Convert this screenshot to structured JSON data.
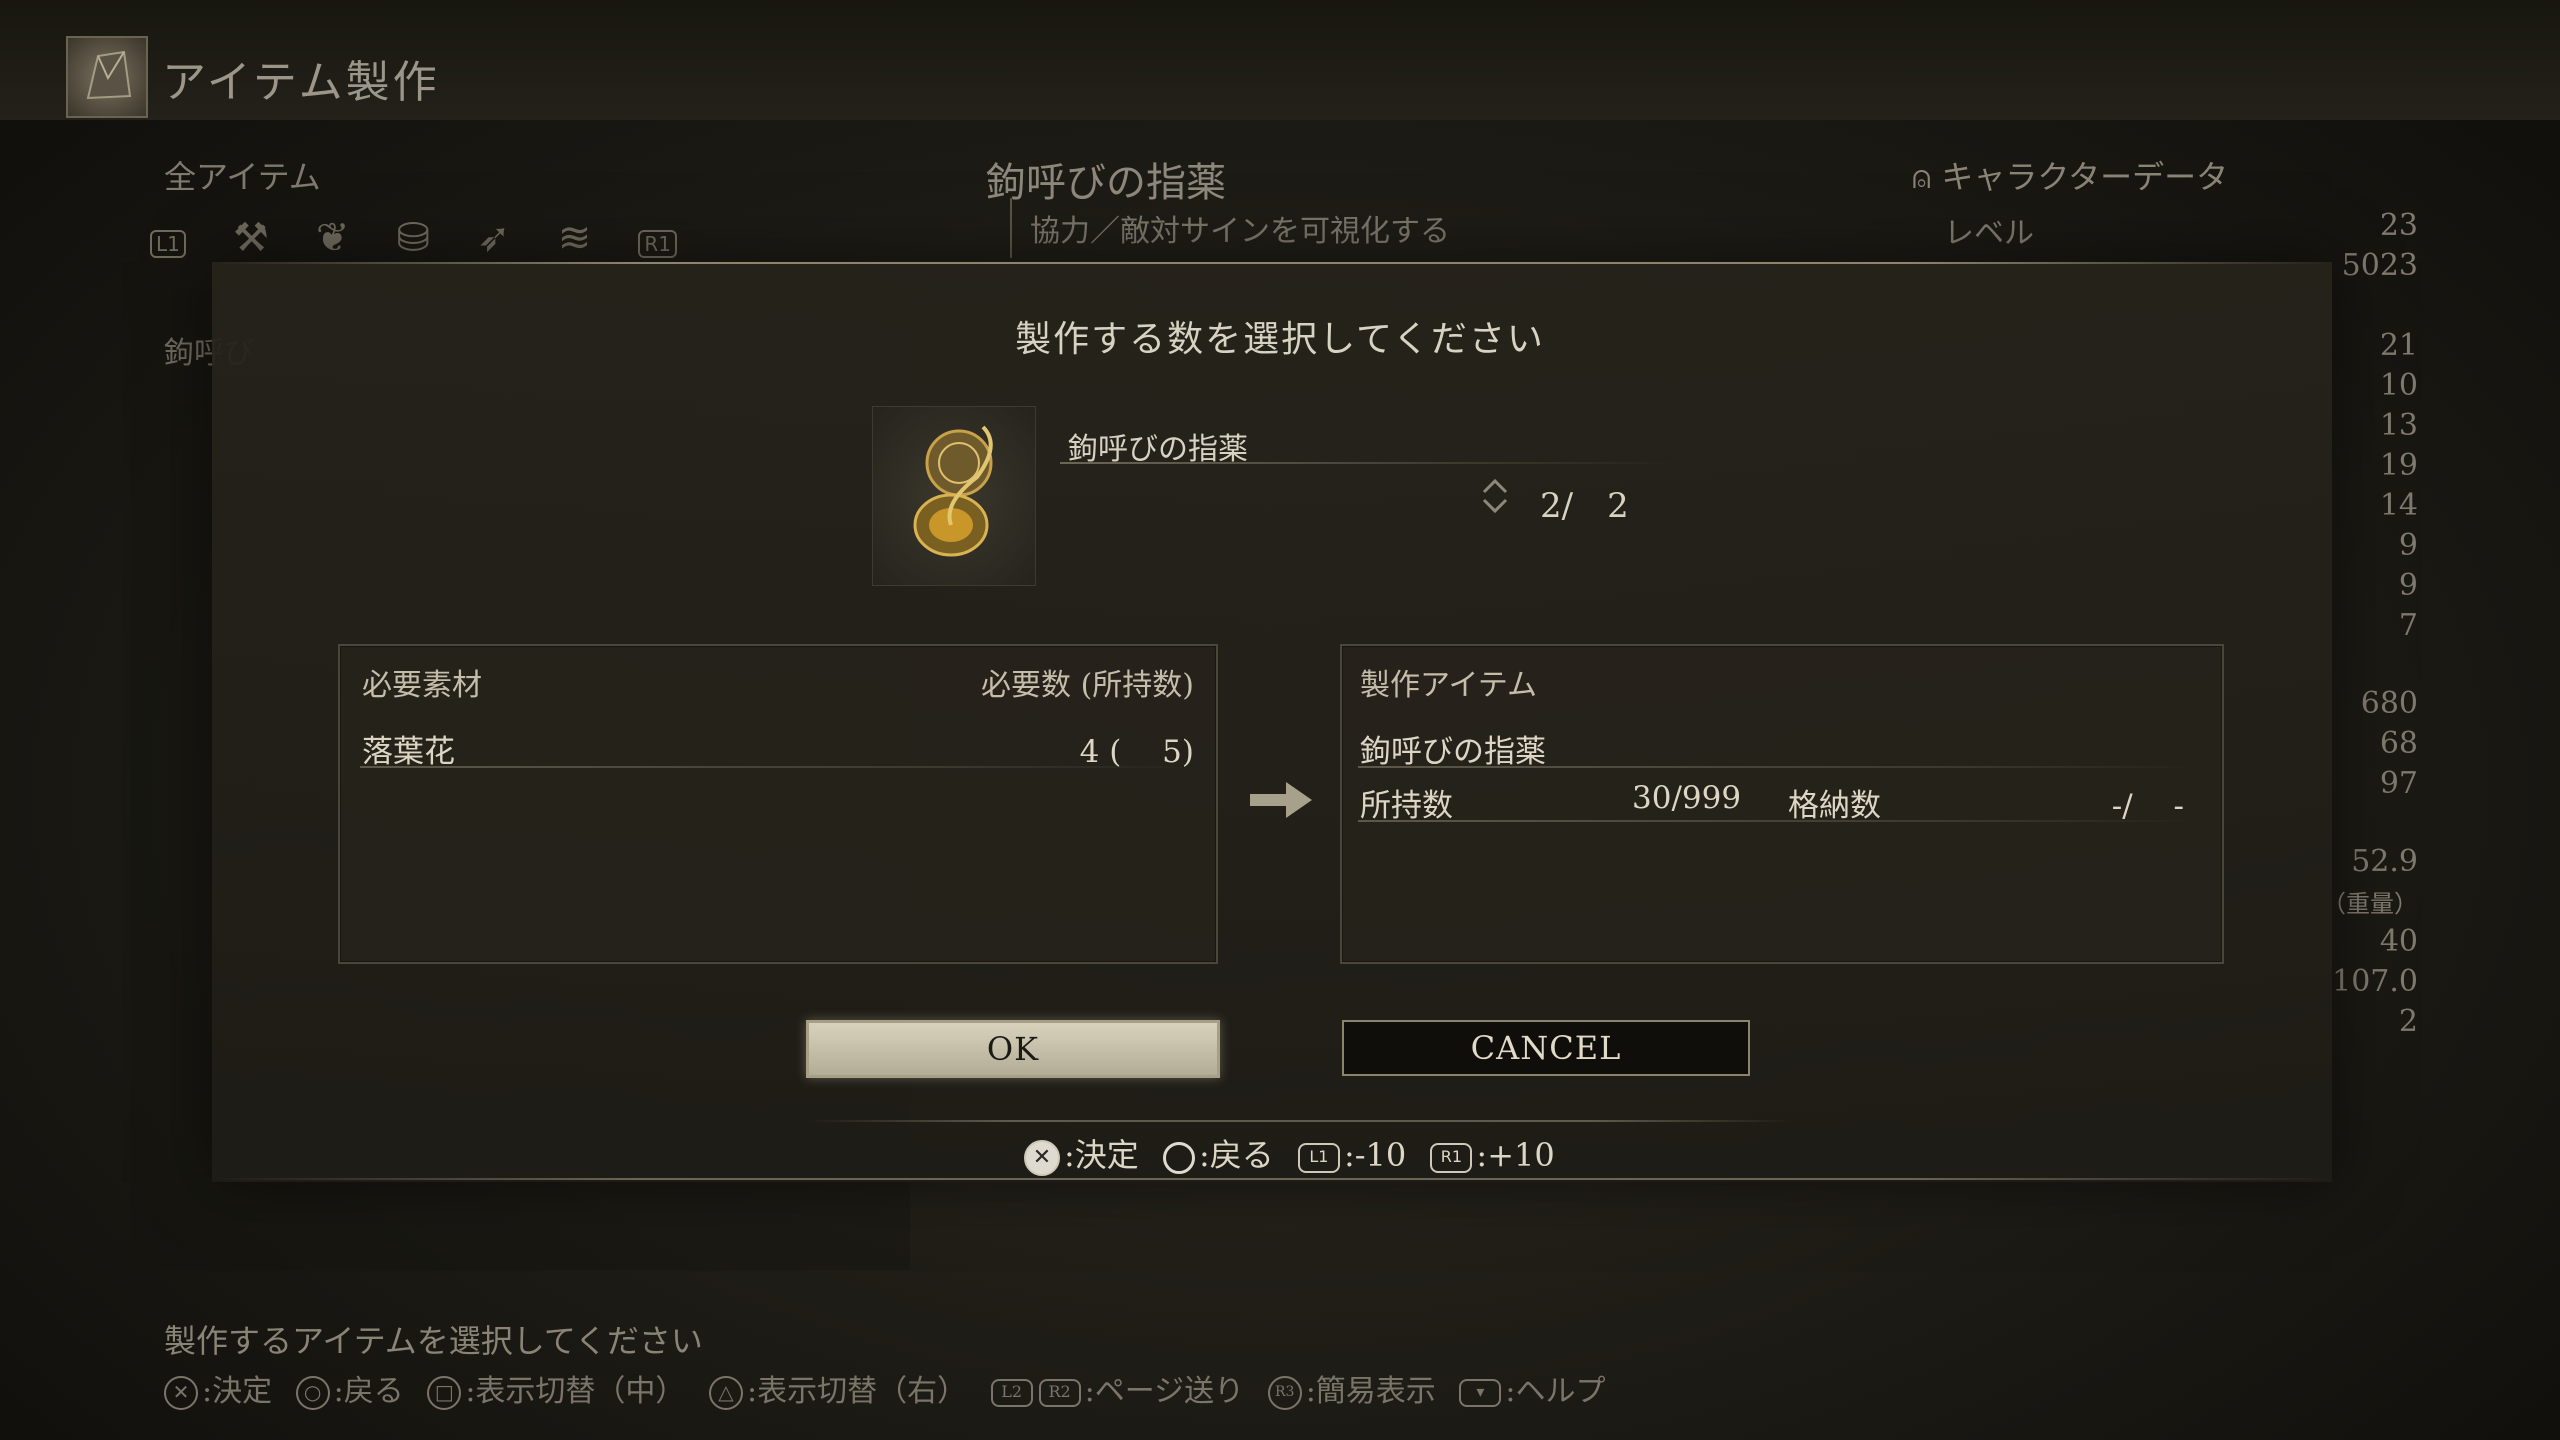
{
  "app": {
    "title": "アイテム製作"
  },
  "category": {
    "label": "全アイテム",
    "tab_left": "L1",
    "tab_right": "R1"
  },
  "background_item": {
    "name": "鉤呼びの指薬",
    "description": "協力／敵対サインを可視化する",
    "list_label": "鉤呼び"
  },
  "character": {
    "header": "キャラクターデータ",
    "level_label": "レベル",
    "level": "23",
    "runes": "5023",
    "stats": [
      "21",
      "10",
      "13",
      "19",
      "14",
      "9",
      "9",
      "7"
    ],
    "hp": "680",
    "fp": "68",
    "stamina": "97",
    "equip_load": "52.9",
    "weight_label": "（重量）",
    "poise": "40",
    "discovery": "107.0",
    "misc": "2"
  },
  "dialog": {
    "title": "製作する数を選択してください",
    "item_name": "鉤呼びの指薬",
    "quantity": "2/　2",
    "materials": {
      "header_left": "必要素材",
      "header_right": "必要数 (所持数)",
      "rows": [
        {
          "name": "落葉花",
          "count": "4 (　 5)"
        }
      ]
    },
    "result": {
      "header": "製作アイテム",
      "name": "鉤呼びの指薬",
      "owned_label": "所持数",
      "owned_value": "30/999",
      "stored_label": "格納数",
      "stored_value": "-/　 -"
    },
    "ok_label": "OK",
    "cancel_label": "CANCEL",
    "hints": {
      "confirm": ":決定",
      "back": ":戻る",
      "l1_key": "L1",
      "minus": ":-10",
      "r1_key": "R1",
      "plus": ":+10"
    }
  },
  "footer": {
    "prompt": "製作するアイテムを選択してください",
    "hints": {
      "confirm": ":決定",
      "back": ":戻る",
      "toggle_mid": ":表示切替（中）",
      "toggle_right": ":表示切替（右）",
      "page": ":ページ送り",
      "simple": ":簡易表示",
      "help": ":ヘルプ",
      "l2": "L2",
      "r2": "R2",
      "r3": "R3"
    }
  }
}
